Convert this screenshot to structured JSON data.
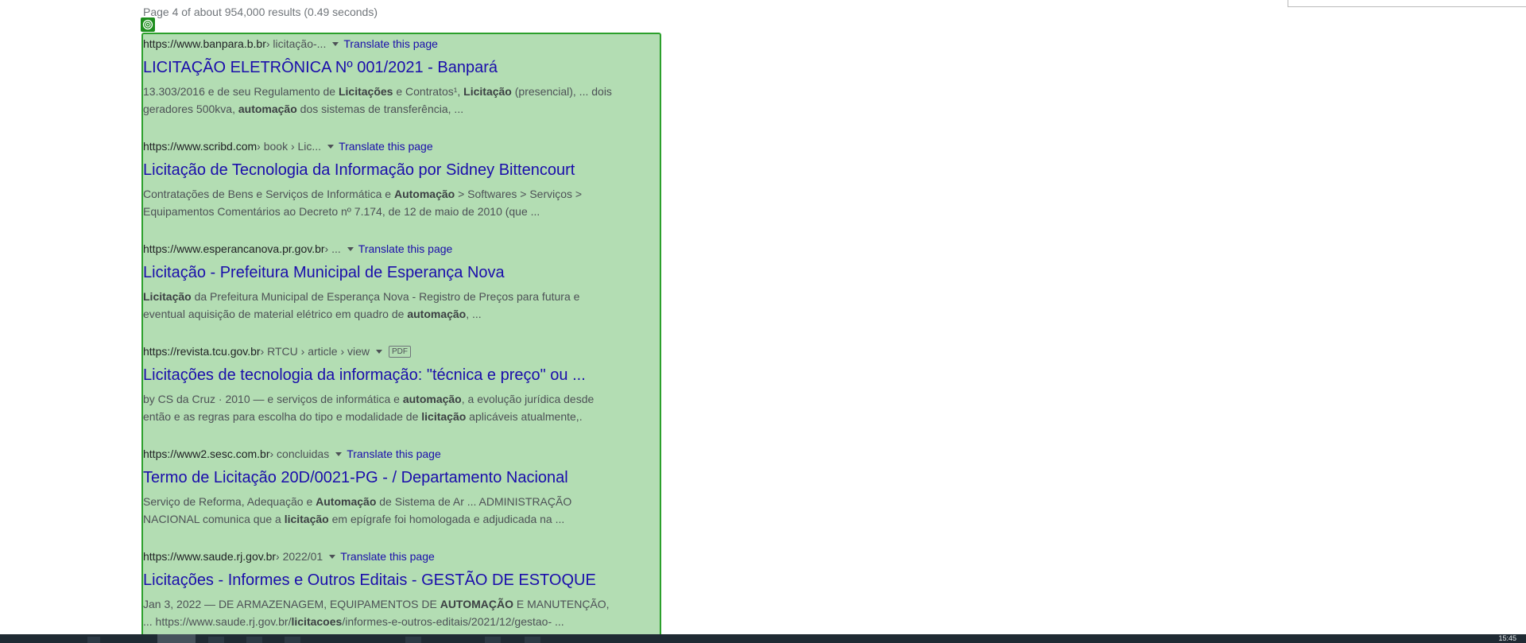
{
  "search_stats": "Page 4 of about 954,000 results (0.49 seconds)",
  "translate_label": "Translate this page",
  "results": [
    {
      "domain": "https://www.banpara.b.br",
      "path": " › licitação-...",
      "title": "LICITAÇÃO ELETRÔNICA Nº 001/2021 - Banpará",
      "snippet": [
        {
          "t": "13.303/2016 e de seu Regulamento de "
        },
        {
          "b": "Licitações"
        },
        {
          "t": " e Contratos¹, "
        },
        {
          "b": "Licitação"
        },
        {
          "t": " (presencial), ... dois geradores 500kva, "
        },
        {
          "b": "automação"
        },
        {
          "t": " dos sistemas de transferência, ..."
        }
      ]
    },
    {
      "domain": "https://www.scribd.com",
      "path": " › book › Lic...",
      "title": "Licitação de Tecnologia da Informação por Sidney Bittencourt",
      "snippet": [
        {
          "t": "Contratações de Bens e Serviços de Informática e "
        },
        {
          "b": "Automação"
        },
        {
          "t": " > Softwares > Serviços > Equipamentos Comentários ao Decreto nº 7.174, de 12 de maio de 2010 (que ..."
        }
      ]
    },
    {
      "domain": "https://www.esperancanova.pr.gov.br",
      "path": " › ...",
      "title": "Licitação - Prefeitura Municipal de Esperança Nova",
      "snippet": [
        {
          "b": "Licitação"
        },
        {
          "t": " da Prefeitura Municipal de Esperança Nova - Registro de Preços para futura e eventual aquisição de material elétrico em quadro de "
        },
        {
          "b": "automação"
        },
        {
          "t": ", ..."
        }
      ]
    },
    {
      "domain": "https://revista.tcu.gov.br",
      "path": " › RTCU › article › view",
      "badge": "PDF",
      "title": "Licitações de tecnologia da informação: \"técnica e preço\" ou ...",
      "snippet": [
        {
          "t": "by CS da Cruz · 2010 — e serviços de informática e "
        },
        {
          "b": "automação"
        },
        {
          "t": ", a evolução jurídica desde então e as regras para escolha do tipo e modalidade de "
        },
        {
          "b": "licitação"
        },
        {
          "t": " aplicáveis atualmente,."
        }
      ]
    },
    {
      "domain": "https://www2.sesc.com.br",
      "path": " › concluidas",
      "title": "Termo de Licitação 20D/0021-PG - / Departamento Nacional",
      "snippet": [
        {
          "t": "Serviço de Reforma, Adequação e "
        },
        {
          "b": "Automação"
        },
        {
          "t": " de Sistema de Ar ... ADMINISTRAÇÃO NACIONAL comunica que a "
        },
        {
          "b": "licitação"
        },
        {
          "t": " em epígrafe foi homologada e adjudicada na ..."
        }
      ]
    },
    {
      "domain": "https://www.saude.rj.gov.br",
      "path": " › 2022/01",
      "title": "Licitações - Informes e Outros Editais - GESTÃO DE ESTOQUE",
      "snippet": [
        {
          "t": "Jan 3, 2022 — DE ARMAZENAGEM, EQUIPAMENTOS DE "
        },
        {
          "b": "AUTOMAÇÃO"
        },
        {
          "t": " E MANUTENÇÃO, ... https://www.saude.rj.gov.br/"
        },
        {
          "b": "licitacoes"
        },
        {
          "t": "/informes-e-outros-editais/2021/12/gestao- ..."
        }
      ]
    }
  ],
  "taskbar": {
    "clock": "15:45"
  },
  "colors": {
    "link": "#1a0dab",
    "snippet": "#4d5156",
    "overlay": "#2ca02c",
    "taskbar": "#1f2a33"
  }
}
